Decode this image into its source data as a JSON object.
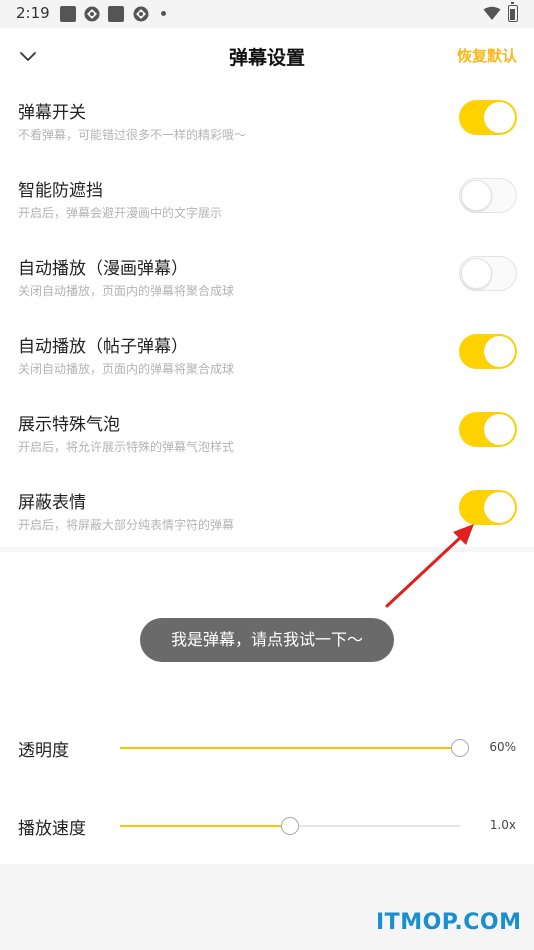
{
  "status_bar": {
    "time": "2:19"
  },
  "header": {
    "title": "弹幕设置",
    "reset_label": "恢复默认"
  },
  "settings": [
    {
      "title": "弹幕开关",
      "desc": "不看弹幕，可能错过很多不一样的精彩哦～",
      "enabled": true
    },
    {
      "title": "智能防遮挡",
      "desc": "开启后，弹幕会避开漫画中的文字展示",
      "enabled": false
    },
    {
      "title": "自动播放（漫画弹幕）",
      "desc": "关闭自动播放，页面内的弹幕将聚合成球",
      "enabled": false
    },
    {
      "title": "自动播放（帖子弹幕）",
      "desc": "关闭自动播放，页面内的弹幕将聚合成球",
      "enabled": true
    },
    {
      "title": "展示特殊气泡",
      "desc": "开启后，将允许展示特殊的弹幕气泡样式",
      "enabled": true
    },
    {
      "title": "屏蔽表情",
      "desc": "开启后，将屏蔽大部分纯表情字符的弹幕",
      "enabled": true
    }
  ],
  "preview": {
    "bubble_text": "我是弹幕，请点我试一下～"
  },
  "sliders": [
    {
      "label": "透明度",
      "value_text": "60%",
      "level": 1.0
    },
    {
      "label": "播放速度",
      "value_text": "1.0x",
      "level": 0.5
    }
  ],
  "colors": {
    "accent": "#ffd200",
    "reset_text": "#f7b91e",
    "watermark": "#1a8fd0",
    "annotation_arrow": "#e0201c"
  },
  "watermark": "ITMOP.COM"
}
